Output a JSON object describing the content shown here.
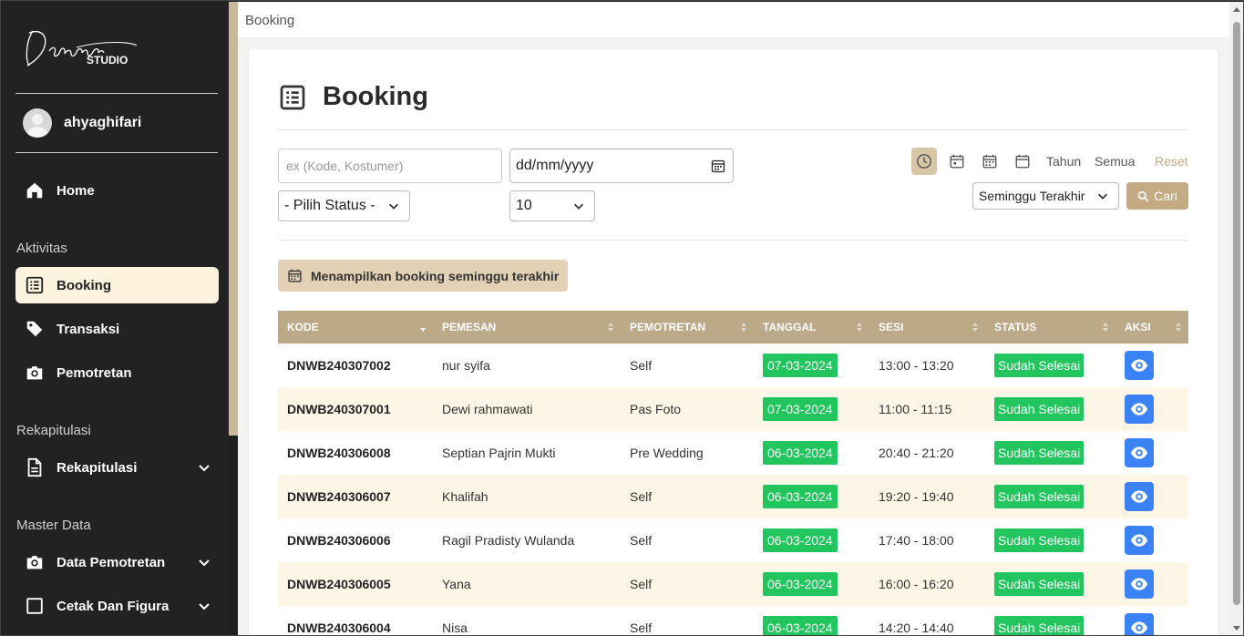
{
  "sidebar": {
    "brand_script": "Danapa",
    "brand_sub": "STUDIO",
    "username": "ahyaghifari",
    "home": "Home",
    "sections": {
      "aktivitas": "Aktivitas",
      "rekapitulasi": "Rekapitulasi",
      "master_data": "Master Data"
    },
    "items": [
      {
        "label": "Booking",
        "icon": "list-icon"
      },
      {
        "label": "Transaksi",
        "icon": "tag-icon"
      },
      {
        "label": "Pemotretan",
        "icon": "camera-icon"
      },
      {
        "label": "Rekapitulasi",
        "icon": "document-icon"
      },
      {
        "label": "Data Pemotretan",
        "icon": "camera-icon"
      },
      {
        "label": "Cetak Dan Figura",
        "icon": "square-icon"
      }
    ]
  },
  "topbar": {
    "breadcrumb": "Booking"
  },
  "page": {
    "title": "Booking",
    "search_placeholder": "ex (Kode, Kostumer)",
    "date_placeholder": "dd/mm/yyyy",
    "status_select": "- Pilih Status -",
    "per_page": "10",
    "quick_filters": {
      "tahun": "Tahun",
      "semua": "Semua",
      "reset": "Reset"
    },
    "period_select": "Seminggu Terakhir",
    "search_button": "Cari",
    "filter_info": "Menampilkan booking seminggu terakhir"
  },
  "table": {
    "headers": [
      "KODE",
      "PEMESAN",
      "PEMOTRETAN",
      "TANGGAL",
      "SESI",
      "STATUS",
      "AKSI"
    ],
    "rows": [
      {
        "kode": "DNWB240307002",
        "pemesan": "nur syifa",
        "pemotretan": "Self",
        "tanggal": "07-03-2024",
        "sesi": "13:00 - 13:20",
        "status": "Sudah Selesai"
      },
      {
        "kode": "DNWB240307001",
        "pemesan": "Dewi rahmawati",
        "pemotretan": "Pas Foto",
        "tanggal": "07-03-2024",
        "sesi": "11:00 - 11:15",
        "status": "Sudah Selesai"
      },
      {
        "kode": "DNWB240306008",
        "pemesan": "Septian Pajrin Mukti",
        "pemotretan": "Pre Wedding",
        "tanggal": "06-03-2024",
        "sesi": "20:40 - 21:20",
        "status": "Sudah Selesai"
      },
      {
        "kode": "DNWB240306007",
        "pemesan": "Khalifah",
        "pemotretan": "Self",
        "tanggal": "06-03-2024",
        "sesi": "19:20 - 19:40",
        "status": "Sudah Selesai"
      },
      {
        "kode": "DNWB240306006",
        "pemesan": "Ragil Pradisty Wulanda",
        "pemotretan": "Self",
        "tanggal": "06-03-2024",
        "sesi": "17:40 - 18:00",
        "status": "Sudah Selesai"
      },
      {
        "kode": "DNWB240306005",
        "pemesan": "Yana",
        "pemotretan": "Self",
        "tanggal": "06-03-2024",
        "sesi": "16:00 - 16:20",
        "status": "Sudah Selesai"
      },
      {
        "kode": "DNWB240306004",
        "pemesan": "Nisa",
        "pemotretan": "Self",
        "tanggal": "06-03-2024",
        "sesi": "14:20 - 14:40",
        "status": "Sudah Selesai"
      }
    ]
  },
  "colors": {
    "sidebar_bg": "#222222",
    "active_item": "#fdf3de",
    "accent": "#c4ab84",
    "table_header": "#bba987",
    "success": "#22c55e",
    "action_blue": "#3b82f6"
  }
}
